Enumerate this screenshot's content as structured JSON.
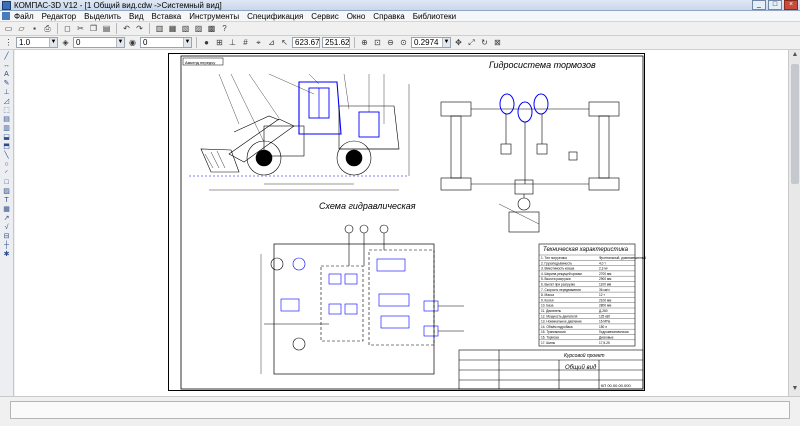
{
  "window": {
    "title": "КОМПАС-3D V12 - [1 Общий вид.cdw ->Системный вид]",
    "controls": [
      "_",
      "□",
      "×"
    ]
  },
  "menu": [
    "Файл",
    "Редактор",
    "Выделить",
    "Вид",
    "Вставка",
    "Инструменты",
    "Спецификация",
    "Сервис",
    "Окно",
    "Справка",
    "Библиотеки"
  ],
  "toolbar2": {
    "step": "1.0",
    "layer": "0",
    "style": "0",
    "coord_x": "623.67",
    "coord_y": "251.62",
    "zoom": "0.2974"
  },
  "drawing": {
    "stamp_tl": "Амкенд передчу",
    "title_hydro_brakes": "Гидросистема тормозов",
    "title_hydraulic_scheme": "Схема гидравлическая",
    "tech_title": "Техническая характеристика",
    "tech_rows": [
      [
        "Тип погрузчика",
        "Фронтальный, уравновешенный"
      ],
      [
        "Грузоподъёмность",
        "4,0 т"
      ],
      [
        "Вместимость ковша",
        "2,3 м³"
      ],
      [
        "Ширина режущей кромки",
        "2700 мм"
      ],
      [
        "Высота разгрузки",
        "2900 мм"
      ],
      [
        "Вылет при разгрузке",
        "1100 мм"
      ],
      [
        "Скорость передвижения",
        "36 км/ч"
      ],
      [
        "Масса",
        "12 т"
      ],
      [
        "Колея",
        "2100 мм"
      ],
      [
        "База",
        "2800 мм"
      ],
      [
        "Двигатель",
        "Д-260"
      ],
      [
        "Мощность двигателя",
        "125 кВт"
      ],
      [
        "Номинальное давление",
        "16 МПа"
      ],
      [
        "Объём гидробака",
        "150 л"
      ],
      [
        "Трансмиссия",
        "Гидромеханическая"
      ],
      [
        "Тормоза",
        "Дисковые"
      ],
      [
        "Шины",
        "17,5-25"
      ]
    ],
    "title_block_name": "Общий вид",
    "title_block_project": "Курсовой проект",
    "title_block_code": "КП 00.00.00.000"
  },
  "colors": {
    "line": "#000000",
    "highlight": "#0000ff",
    "workspace": "#ffffff"
  }
}
